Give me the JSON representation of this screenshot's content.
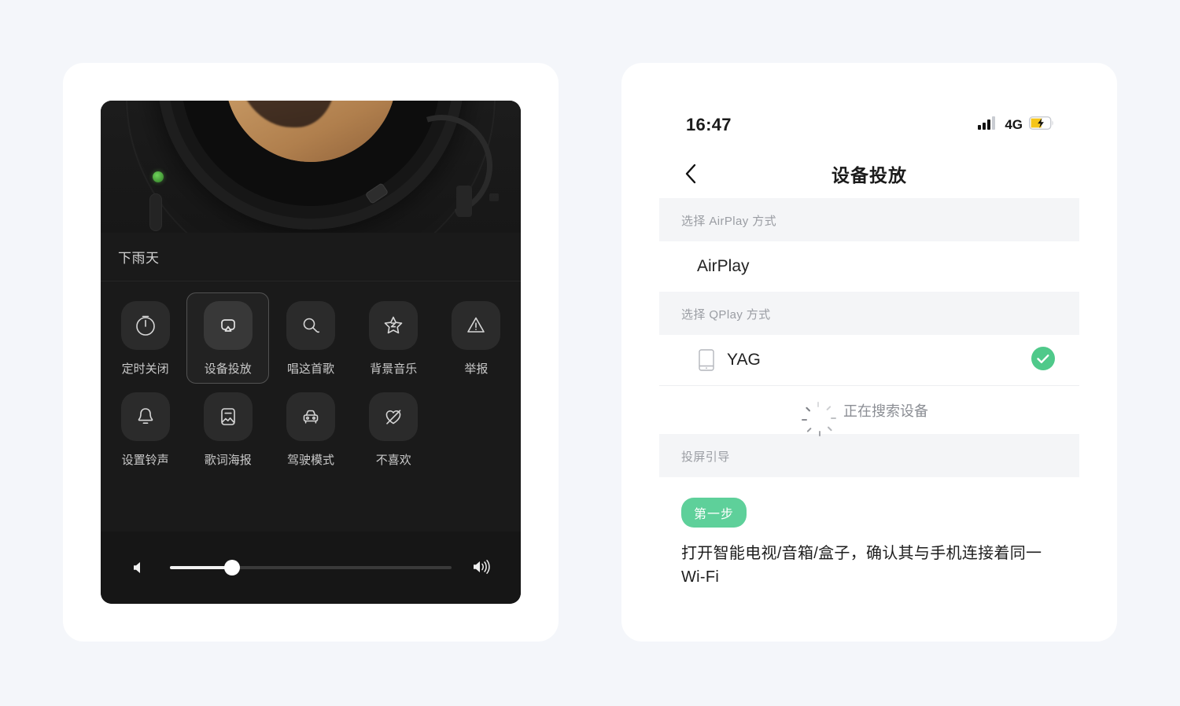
{
  "page": {
    "background_color": "#f4f6fa",
    "card_background": "#ffffff"
  },
  "left_panel": {
    "name": "music-player-more-panel",
    "background_color": "#1a1a1a",
    "track": {
      "title": "下雨天"
    },
    "actions": [
      {
        "label": "定时关闭",
        "icon": "timer-icon",
        "selected": false
      },
      {
        "label": "设备投放",
        "icon": "cast-icon",
        "selected": true
      },
      {
        "label": "唱这首歌",
        "icon": "sing-mic-icon",
        "selected": false
      },
      {
        "label": "背景音乐",
        "icon": "star-music-icon",
        "selected": false
      },
      {
        "label": "举报",
        "icon": "report-warning-icon",
        "selected": false
      },
      {
        "label": "设置铃声",
        "icon": "bell-icon",
        "selected": false
      },
      {
        "label": "歌词海报",
        "icon": "poster-image-icon",
        "selected": false
      },
      {
        "label": "驾驶模式",
        "icon": "car-icon",
        "selected": false
      },
      {
        "label": "不喜欢",
        "icon": "broken-heart-icon",
        "selected": false
      }
    ],
    "volume": {
      "min_icon": "volume-low-icon",
      "max_icon": "volume-high-icon",
      "percent": 22
    }
  },
  "right_panel": {
    "name": "device-cast-screen",
    "status_bar": {
      "time": "16:47",
      "signal_icon": "signal-bars-icon",
      "network": "4G",
      "battery_icon": "battery-charging-icon",
      "battery_color": "#f5c518"
    },
    "nav": {
      "back_icon": "chevron-left-icon",
      "title": "设备投放"
    },
    "sections": [
      {
        "header": "选择 AirPlay 方式",
        "rows": [
          {
            "label": "AirPlay",
            "icon": null,
            "checked": false
          }
        ]
      },
      {
        "header": "选择 QPlay 方式",
        "rows": [
          {
            "label": "YAG",
            "icon": "device-phone-icon",
            "checked": true
          }
        ],
        "searching": {
          "icon": "loading-spinner-icon",
          "text": "正在搜索设备"
        }
      },
      {
        "header": "投屏引导",
        "guide": {
          "badge": "第一步",
          "badge_color": "#5ed09a",
          "text": "打开智能电视/音箱/盒子，确认其与手机连接着同一Wi-Fi"
        }
      }
    ],
    "accent_color": "#4fc98a"
  }
}
